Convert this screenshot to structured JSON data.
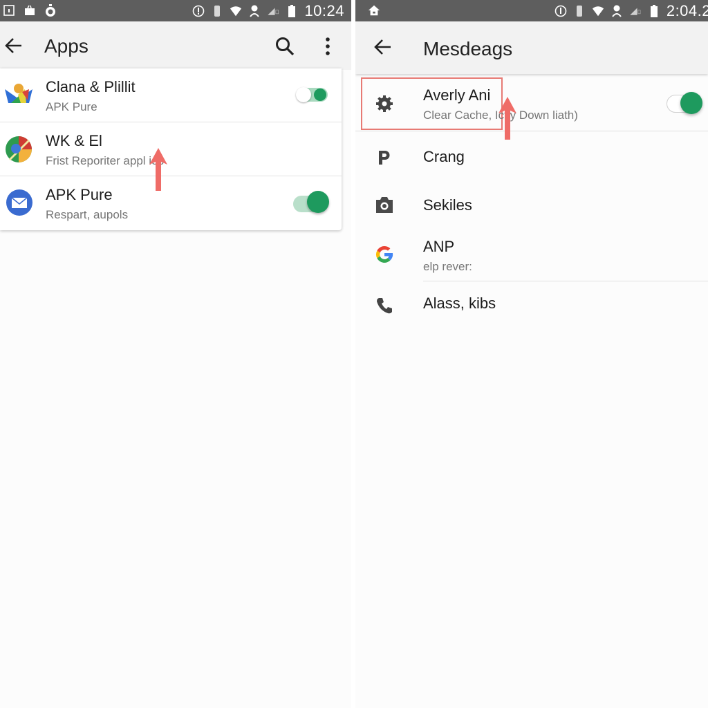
{
  "left_screen": {
    "status_bar": {
      "left_icons": [
        "screenshot-icon",
        "bag-icon",
        "timer-icon"
      ],
      "right_icons": [
        "alert-icon",
        "vibrate-icon",
        "wifi-icon",
        "data-saver-icon",
        "signal-icon",
        "battery-icon"
      ],
      "time": "10:24"
    },
    "app_bar": {
      "back_icon": "arrow-back-icon",
      "title": "Apps",
      "actions": [
        "search-icon",
        "more-vert-icon"
      ]
    },
    "items": [
      {
        "icon": "bird-app-icon",
        "title": "Clana & Plillit",
        "subtitle": "APK Pure",
        "toggle": {
          "on": true,
          "state": "partial"
        }
      },
      {
        "icon": "chrome-like-app-icon",
        "title": "WK & El",
        "subtitle": "Frist Reporiter appl ies",
        "toggle": null
      },
      {
        "icon": "mail-app-icon",
        "title": "APK Pure",
        "subtitle": "Respart, aupols",
        "toggle": {
          "on": true,
          "state": "on"
        }
      }
    ],
    "annotation_arrow": "arrow-up-annotation"
  },
  "right_screen": {
    "status_bar": {
      "left_icons": [
        "home-icon"
      ],
      "right_icons": [
        "alert-icon",
        "vibrate-icon",
        "wifi-icon",
        "data-saver-icon",
        "signal-icon",
        "battery-icon"
      ],
      "time": "2:04.2"
    },
    "app_bar": {
      "back_icon": "arrow-back-icon",
      "title": "Mesdeags"
    },
    "items": [
      {
        "icon": "settings-gear-icon",
        "title": "Averly Ani",
        "subtitle": "Clear Cache,  Ictly Down liath)",
        "toggle": {
          "on": true
        },
        "highlighted": true
      },
      {
        "icon": "parking-p-icon",
        "title": "Crang",
        "subtitle": ""
      },
      {
        "icon": "camera-icon",
        "title": "Sekiles",
        "subtitle": ""
      },
      {
        "icon": "google-g-icon",
        "title": "ANP",
        "subtitle": "elp rever:"
      },
      {
        "icon": "phone-icon",
        "title": "Alass, kibs",
        "subtitle": ""
      }
    ],
    "annotation_arrow": "arrow-up-annotation"
  },
  "colors": {
    "status_bar": "#5e5e5e",
    "app_bar": "#f2f2f2",
    "toggle_green": "#1e9a5e",
    "toggle_track": "#a9d9bf",
    "annotation_red": "#ef6c67"
  }
}
